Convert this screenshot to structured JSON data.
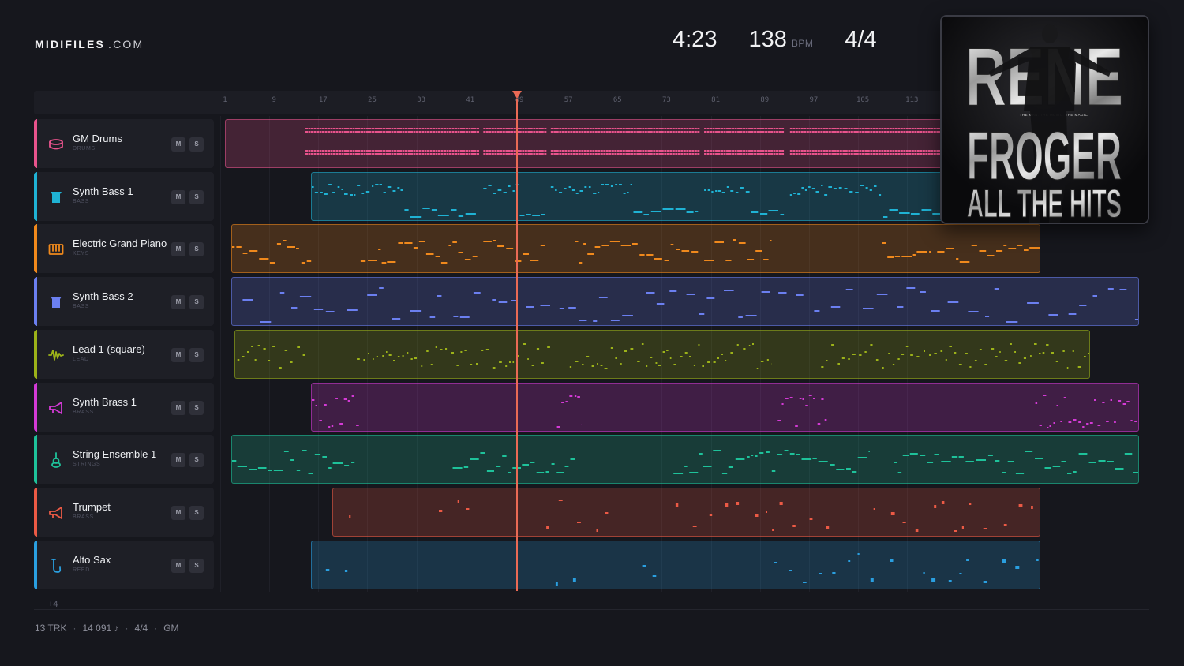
{
  "brand": {
    "name": "MIDIFILES",
    "domain": ".COM"
  },
  "stats": {
    "duration": "4:23",
    "tempo": "138",
    "tempo_unit": "BPM",
    "time_signature": "4/4"
  },
  "ruler": {
    "labels": [
      "1",
      "9",
      "17",
      "25",
      "33",
      "41",
      "49",
      "57",
      "65",
      "73",
      "81",
      "89",
      "97",
      "105",
      "113"
    ]
  },
  "playhead": {
    "bar": 49.5,
    "color": "#ea6a55"
  },
  "tracks": [
    {
      "name": "GM Drums",
      "category": "DRUMS",
      "color": "#e8538c",
      "icon": "drum-icon",
      "mute": "M",
      "solo": "S"
    },
    {
      "name": "Synth Bass 1",
      "category": "BASS",
      "color": "#1fb2d4",
      "icon": "bass-icon",
      "mute": "M",
      "solo": "S"
    },
    {
      "name": "Electric Grand Piano",
      "category": "KEYS",
      "color": "#f0891c",
      "icon": "piano-icon",
      "mute": "M",
      "solo": "S"
    },
    {
      "name": "Synth Bass 2",
      "category": "BASS",
      "color": "#6b7ff0",
      "icon": "bass-icon",
      "mute": "M",
      "solo": "S"
    },
    {
      "name": "Lead 1 (square)",
      "category": "LEAD",
      "color": "#9cb219",
      "icon": "wave-icon",
      "mute": "M",
      "solo": "S"
    },
    {
      "name": "Synth Brass 1",
      "category": "BRASS",
      "color": "#d43ad6",
      "icon": "horn-icon",
      "mute": "M",
      "solo": "S"
    },
    {
      "name": "String Ensemble 1",
      "category": "STRINGS",
      "color": "#1ec29a",
      "icon": "violin-icon",
      "mute": "M",
      "solo": "S"
    },
    {
      "name": "Trumpet",
      "category": "BRASS",
      "color": "#ec5a45",
      "icon": "horn-icon",
      "mute": "M",
      "solo": "S"
    },
    {
      "name": "Alto Sax",
      "category": "REED",
      "color": "#2a9fe0",
      "icon": "sax-icon",
      "mute": "M",
      "solo": "S"
    }
  ],
  "more_tracks": "+4",
  "footer": {
    "tracks": "13 TRK",
    "notes": "14 091 ♪",
    "meter": "4/4",
    "standard": "GM"
  },
  "cover": {
    "line1": "RENE",
    "line2": "FROGER",
    "line3": "ALL THE HITS",
    "tagline": "THE MAN. THE MUSIC. THE MAGIC"
  }
}
